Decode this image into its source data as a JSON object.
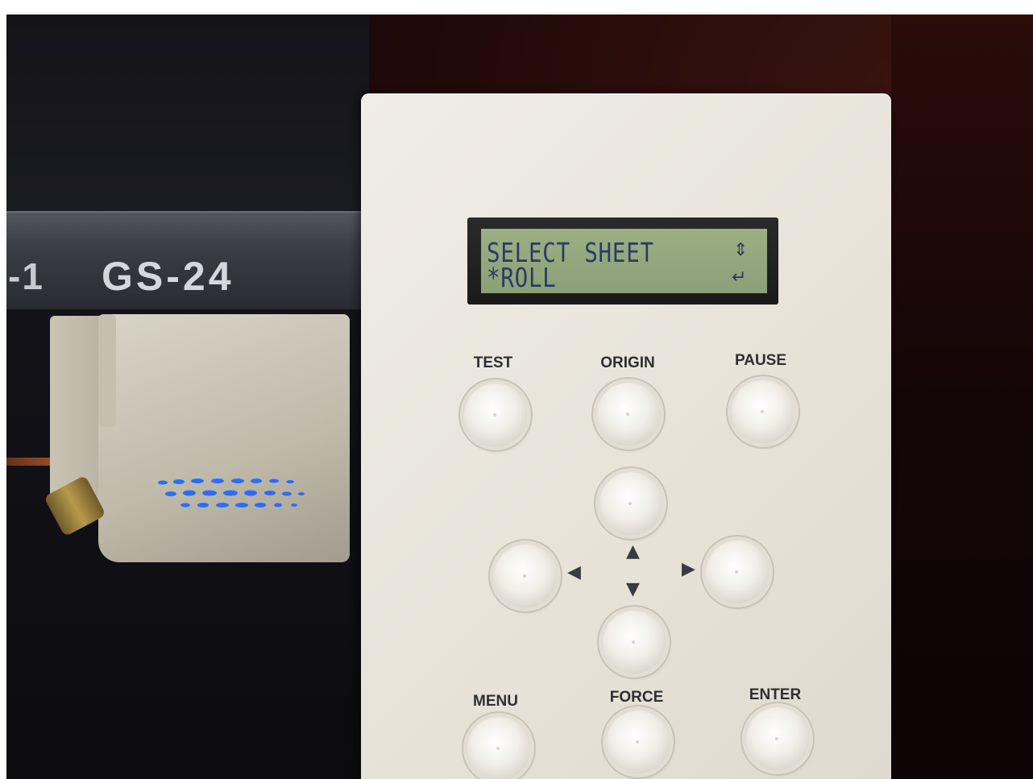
{
  "printer": {
    "model_partial": "-1",
    "model": "GS-24"
  },
  "lcd": {
    "line1": "SELECT SHEET",
    "line2": "*ROLL",
    "icons": [
      "up-down-arrows-icon",
      "enter-return-icon"
    ]
  },
  "buttons": {
    "test": "TEST",
    "origin": "ORIGIN",
    "pause": "PAUSE",
    "menu": "MENU",
    "force": "FORCE",
    "enter": "ENTER"
  },
  "arrows": {
    "up": "▲",
    "down": "▼",
    "left": "◀",
    "right": "▶"
  },
  "colors": {
    "panel": "#ebe7de",
    "lcd_background": "#94a97f",
    "lcd_text": "#2b3a63",
    "carriage_led": "#2a6cff"
  }
}
